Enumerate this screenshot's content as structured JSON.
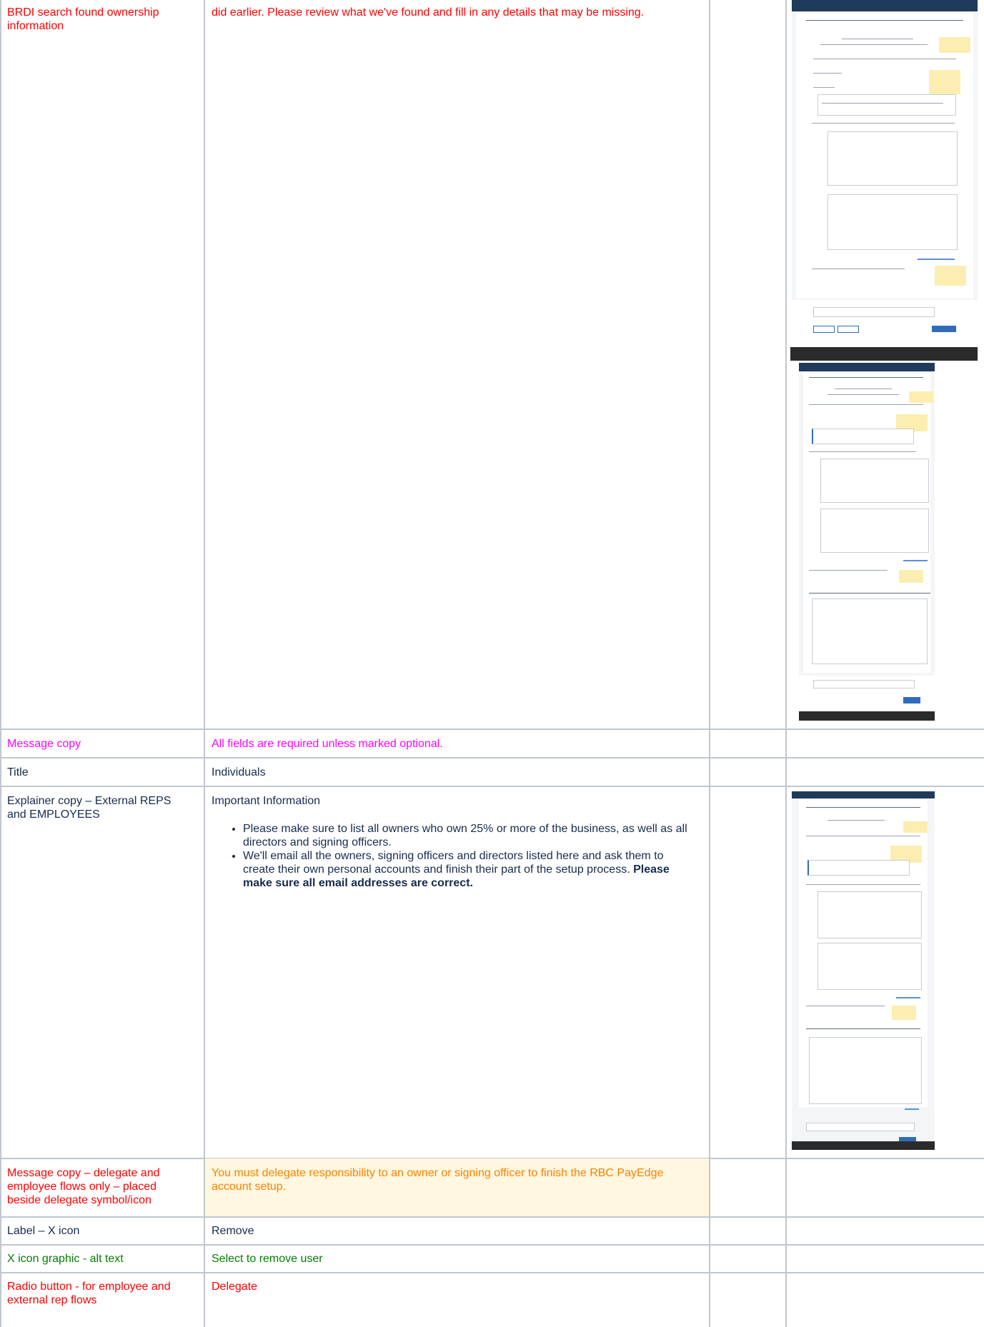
{
  "rows": [
    {
      "label": "BRDI search found ownership information",
      "value": "did earlier. Please review what we've found and fill in any details that may be missing."
    },
    {
      "label": "Message copy",
      "value": "All fields are required unless marked optional."
    },
    {
      "label": "Title",
      "value": "Individuals"
    },
    {
      "label": "Explainer copy – External REPS and EMPLOYEES",
      "heading": "Important Information",
      "bullets": [
        {
          "text": "Please make sure to list all owners who own 25% or more of the business, as well as all directors and signing officers.",
          "bold": ""
        },
        {
          "text": "We'll email all the owners, signing officers and directors listed here and ask them to create their own personal accounts and finish their part of the setup process. ",
          "bold": "Please make sure all email addresses are correct."
        }
      ]
    },
    {
      "label": "Message copy – delegate and employee flows only – placed beside delegate symbol/icon",
      "value": "You must delegate responsibility to an owner or signing officer to finish the RBC PayEdge account setup."
    },
    {
      "label": "Label – X icon",
      "value": "Remove"
    },
    {
      "label": "X icon graphic - alt text",
      "value": "Select to remove user"
    },
    {
      "label": "Radio button - for employee and external rep flows",
      "value": "Delegate"
    }
  ],
  "colors": {
    "red": "#ff0000",
    "magenta": "#ff00ff",
    "green": "#008000",
    "orange": "#ff8000",
    "highlight": "#fff7e0",
    "grid": "#c1c7d0"
  }
}
